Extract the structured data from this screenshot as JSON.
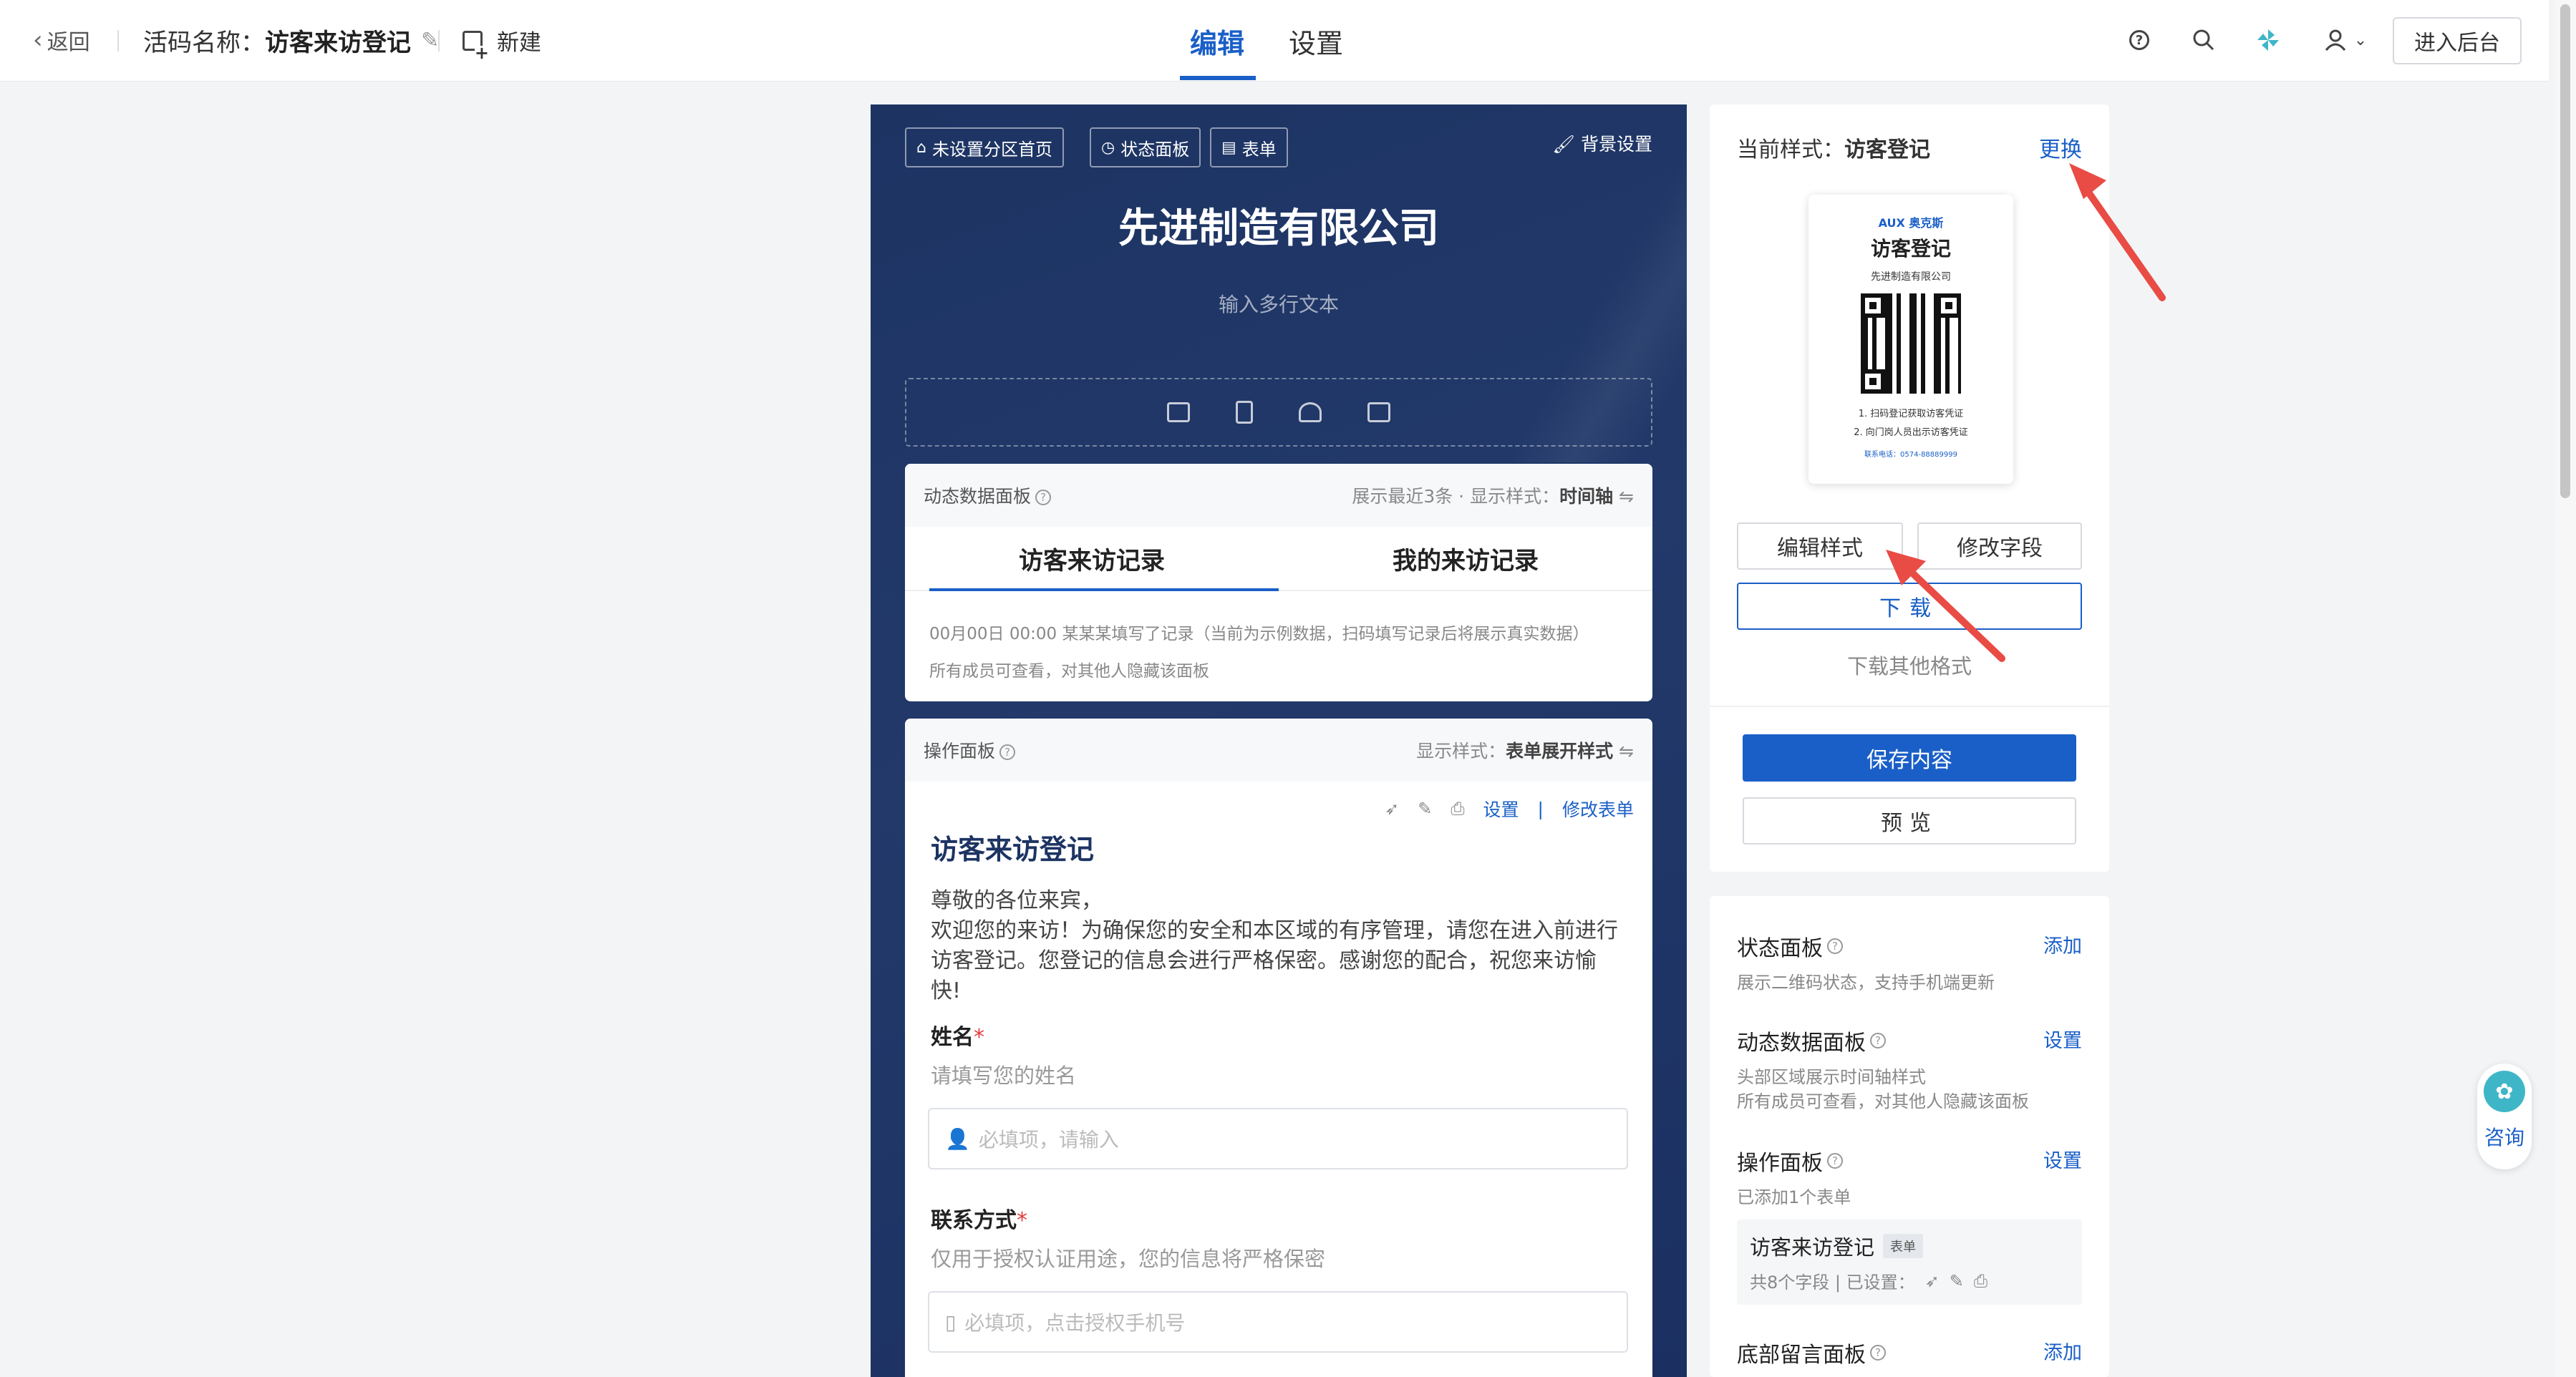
{
  "topbar": {
    "back_label": "返回",
    "title_prefix": "活码名称：",
    "title_name": "访客来访登记",
    "new_label": "新建",
    "tabs": [
      {
        "label": "编辑"
      },
      {
        "label": "设置"
      }
    ],
    "enter_backend_label": "进入后台"
  },
  "preview": {
    "chips": [
      "未设置分区首页",
      "状态面板",
      "表单"
    ],
    "bg_settings_label": "背景设置",
    "company_name": "先进制造有限公司",
    "multiline_placeholder": "输入多行文本",
    "dynamic_panel": {
      "title": "动态数据面板",
      "right_prefix": "展示最近3条 · 显示样式：",
      "right_value": "时间轴",
      "tabs": [
        "访客来访记录",
        "我的来访记录"
      ],
      "log_line": "00月00日 00:00    某某某填写了记录（当前为示例数据，扫码填写记录后将展示真实数据）",
      "visibility_note": "所有成员可查看，对其他人隐藏该面板"
    },
    "op_panel": {
      "title": "操作面板",
      "right_prefix": "显示样式：",
      "right_value": "表单展开样式",
      "settings_link": "设置",
      "separator": "|",
      "edit_form_link": "修改表单",
      "form_title": "访客来访登记",
      "intro_line1": "尊敬的各位来宾，",
      "intro_line2": "欢迎您的来访！为确保您的安全和本区域的有序管理，请您在进入前进行访客登记。您登记的信息会进行严格保密。感谢您的配合，祝您来访愉快!",
      "fields": [
        {
          "label": "姓名",
          "required_mark": "*",
          "hint": "请填写您的姓名",
          "placeholder": "必填项，请输入"
        },
        {
          "label": "联系方式",
          "required_mark": "*",
          "hint": "仅用于授权认证用途，您的信息将严格保密",
          "placeholder": "必填项，点击授权手机号"
        }
      ]
    }
  },
  "style_panel": {
    "current_label": "当前样式：",
    "current_value": "访客登记",
    "change_link": "更换",
    "thumbnail": {
      "brand": "AUX 奥克斯",
      "title": "访客登记",
      "company": "先进制造有限公司",
      "step1": "1. 扫码登记获取访客凭证",
      "step2": "2. 向门岗人员出示访客凭证",
      "footer": "联系电话：0574-88889999"
    },
    "edit_style_label": "编辑样式",
    "modify_fields_label": "修改字段",
    "download_label": "下载",
    "download_other_label": "下载其他格式",
    "save_label": "保存内容",
    "preview_label": "预览"
  },
  "components_panel": {
    "sections": [
      {
        "title": "状态面板",
        "action": "添加",
        "desc": "展示二维码状态，支持手机端更新"
      },
      {
        "title": "动态数据面板",
        "action": "设置",
        "desc": "头部区域展示时间轴样式\n所有成员可查看，对其他人隐藏该面板"
      },
      {
        "title": "操作面板",
        "action": "设置",
        "desc": "已添加1个表单"
      },
      {
        "title": "底部留言面板",
        "action": "添加",
        "desc": ""
      }
    ],
    "form_item": {
      "name": "访客来访登记",
      "tag": "表单",
      "meta": "共8个字段 | 已设置："
    }
  },
  "float": {
    "consult_label": "咨询"
  },
  "colors": {
    "accent": "#1a5fc7",
    "preview_bg": "#1d3463",
    "annotation_arrow": "#e94b45"
  }
}
